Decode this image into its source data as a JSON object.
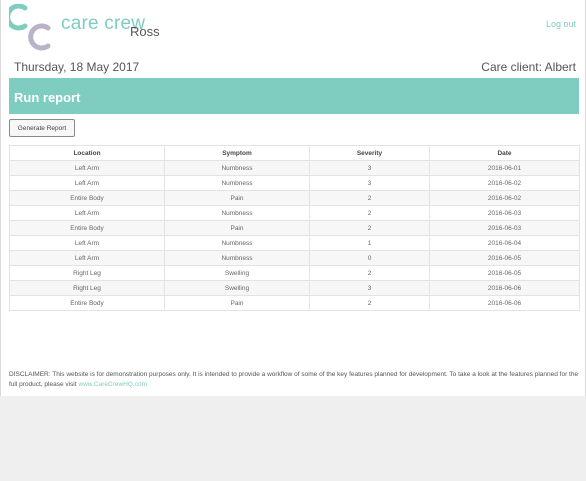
{
  "header": {
    "brand": "care crew",
    "user_name": "Ross",
    "logout_label": "Log out",
    "date": "Thursday, 18 May 2017",
    "care_client": "Care client: Albert",
    "logo_icon": "care-crew-logo",
    "accent_color": "#7fcdc1",
    "logo_secondary_color": "#b9b2c9"
  },
  "banner": {
    "title": "Run report"
  },
  "actions": {
    "generate_label": "Generate Report"
  },
  "report": {
    "columns": [
      "Location",
      "Symptom",
      "Severity",
      "Date"
    ],
    "rows": [
      [
        "Left Arm",
        "Numbness",
        "3",
        "2016-06-01"
      ],
      [
        "Left Arm",
        "Numbness",
        "3",
        "2016-06-02"
      ],
      [
        "Entire Body",
        "Pain",
        "2",
        "2016-06-02"
      ],
      [
        "Left Arm",
        "Numbness",
        "2",
        "2016-06-03"
      ],
      [
        "Entire Body",
        "Pain",
        "2",
        "2016-06-03"
      ],
      [
        "Left Arm",
        "Numbness",
        "1",
        "2016-06-04"
      ],
      [
        "Left Arm",
        "Numbness",
        "0",
        "2016-06-05"
      ],
      [
        "Right Leg",
        "Swelling",
        "2",
        "2016-06-05"
      ],
      [
        "Right Leg",
        "Swelling",
        "3",
        "2016-06-06"
      ],
      [
        "Entire Body",
        "Pain",
        "2",
        "2016-06-06"
      ]
    ]
  },
  "footer": {
    "disclaimer_label": "DISCLAIMER:",
    "disclaimer_text": " This website is for demonstration purposes only. It is intended to provide a workflow of some of the key features planned for development. To take a look at the features planned for the full product, please visit ",
    "link_text": "www.CareCrewHQ.com"
  }
}
